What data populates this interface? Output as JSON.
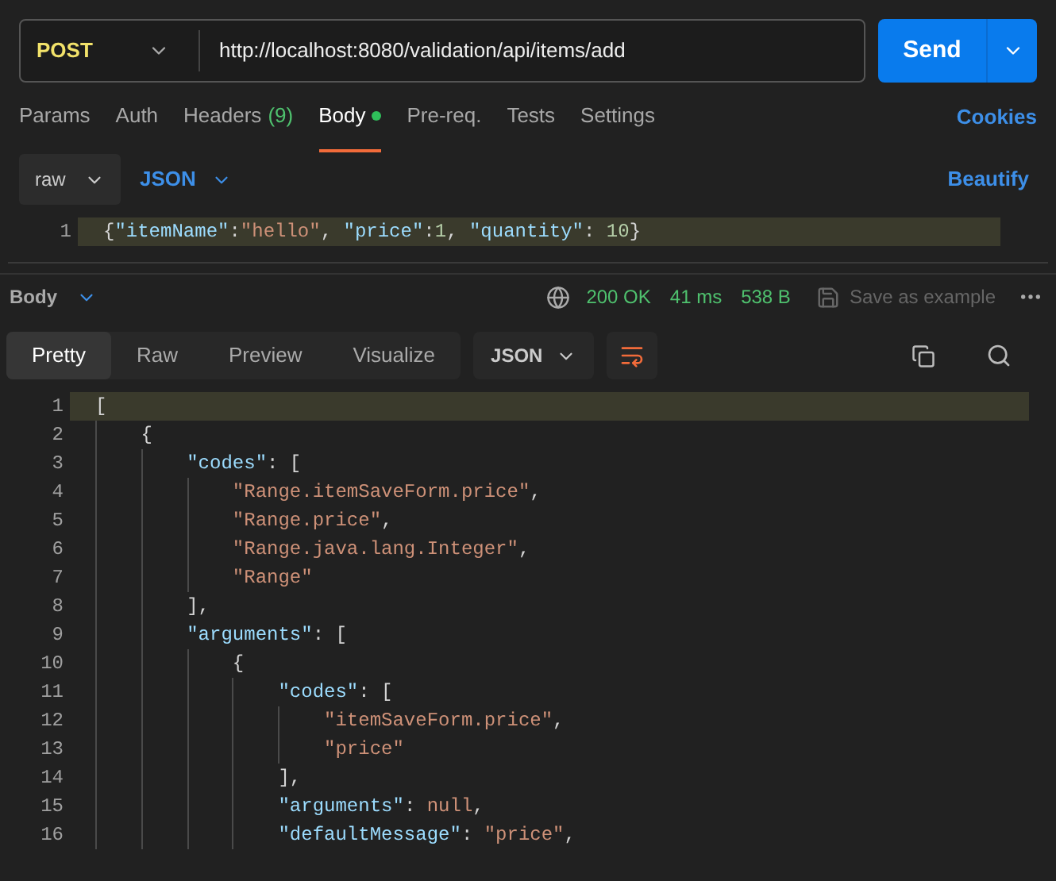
{
  "request": {
    "method": "POST",
    "url": "http://localhost:8080/validation/api/items/add",
    "send": "Send"
  },
  "tabs": [
    {
      "label": "Params",
      "selected": false
    },
    {
      "label": "Auth",
      "selected": false
    },
    {
      "label": "Headers",
      "count": "(9)",
      "selected": false
    },
    {
      "label": "Body",
      "selected": true,
      "dot": true
    },
    {
      "label": "Pre-req.",
      "selected": false
    },
    {
      "label": "Tests",
      "selected": false
    },
    {
      "label": "Settings",
      "selected": false
    }
  ],
  "cookies": "Cookies",
  "body_options": {
    "mode": "raw",
    "language": "JSON",
    "beautify": "Beautify"
  },
  "request_body": [
    {
      "number": "1",
      "tokens": [
        {
          "kind": "punct",
          "text": "{"
        },
        {
          "kind": "key",
          "text": "\"itemName\""
        },
        {
          "kind": "punct",
          "text": ":"
        },
        {
          "kind": "string",
          "text": "\"hello\""
        },
        {
          "kind": "punct",
          "text": ", "
        },
        {
          "kind": "key",
          "text": "\"price\""
        },
        {
          "kind": "punct",
          "text": ":"
        },
        {
          "kind": "number",
          "text": "1"
        },
        {
          "kind": "punct",
          "text": ", "
        },
        {
          "kind": "key",
          "text": "\"quantity\""
        },
        {
          "kind": "punct",
          "text": ": "
        },
        {
          "kind": "number",
          "text": "10"
        },
        {
          "kind": "punct",
          "text": "}"
        }
      ]
    }
  ],
  "response": {
    "label": "Body",
    "status": "200 OK",
    "time": "41 ms",
    "size": "538 B",
    "save": "Save as example"
  },
  "view_tabs": [
    {
      "label": "Pretty",
      "selected": true
    },
    {
      "label": "Raw",
      "selected": false
    },
    {
      "label": "Preview",
      "selected": false
    },
    {
      "label": "Visualize",
      "selected": false
    }
  ],
  "format": "JSON",
  "response_body": [
    {
      "number": "1",
      "tokens": [
        {
          "kind": "punct",
          "text": "["
        }
      ]
    },
    {
      "number": "2",
      "tokens": [
        {
          "kind": "punct",
          "text": "    {"
        }
      ]
    },
    {
      "number": "3",
      "tokens": [
        {
          "kind": "key",
          "text": "        \"codes\""
        },
        {
          "kind": "punct",
          "text": ": ["
        }
      ]
    },
    {
      "number": "4",
      "tokens": [
        {
          "kind": "string",
          "text": "            \"Range.itemSaveForm.price\""
        },
        {
          "kind": "punct",
          "text": ","
        }
      ]
    },
    {
      "number": "5",
      "tokens": [
        {
          "kind": "string",
          "text": "            \"Range.price\""
        },
        {
          "kind": "punct",
          "text": ","
        }
      ]
    },
    {
      "number": "6",
      "tokens": [
        {
          "kind": "string",
          "text": "            \"Range.java.lang.Integer\""
        },
        {
          "kind": "punct",
          "text": ","
        }
      ]
    },
    {
      "number": "7",
      "tokens": [
        {
          "kind": "string",
          "text": "            \"Range\""
        }
      ]
    },
    {
      "number": "8",
      "tokens": [
        {
          "kind": "punct",
          "text": "        ],"
        }
      ]
    },
    {
      "number": "9",
      "tokens": [
        {
          "kind": "key",
          "text": "        \"arguments\""
        },
        {
          "kind": "punct",
          "text": ": ["
        }
      ]
    },
    {
      "number": "10",
      "tokens": [
        {
          "kind": "punct",
          "text": "            {"
        }
      ]
    },
    {
      "number": "11",
      "tokens": [
        {
          "kind": "key",
          "text": "                \"codes\""
        },
        {
          "kind": "punct",
          "text": ": ["
        }
      ]
    },
    {
      "number": "12",
      "tokens": [
        {
          "kind": "string",
          "text": "                    \"itemSaveForm.price\""
        },
        {
          "kind": "punct",
          "text": ","
        }
      ]
    },
    {
      "number": "13",
      "tokens": [
        {
          "kind": "string",
          "text": "                    \"price\""
        }
      ]
    },
    {
      "number": "14",
      "tokens": [
        {
          "kind": "punct",
          "text": "                ],"
        }
      ]
    },
    {
      "number": "15",
      "tokens": [
        {
          "kind": "key",
          "text": "                \"arguments\""
        },
        {
          "kind": "punct",
          "text": ": "
        },
        {
          "kind": "null",
          "text": "null"
        },
        {
          "kind": "punct",
          "text": ","
        }
      ]
    },
    {
      "number": "16",
      "tokens": [
        {
          "kind": "key",
          "text": "                \"defaultMessage\""
        },
        {
          "kind": "punct",
          "text": ": "
        },
        {
          "kind": "string",
          "text": "\"price\""
        },
        {
          "kind": "punct",
          "text": ","
        }
      ]
    }
  ]
}
